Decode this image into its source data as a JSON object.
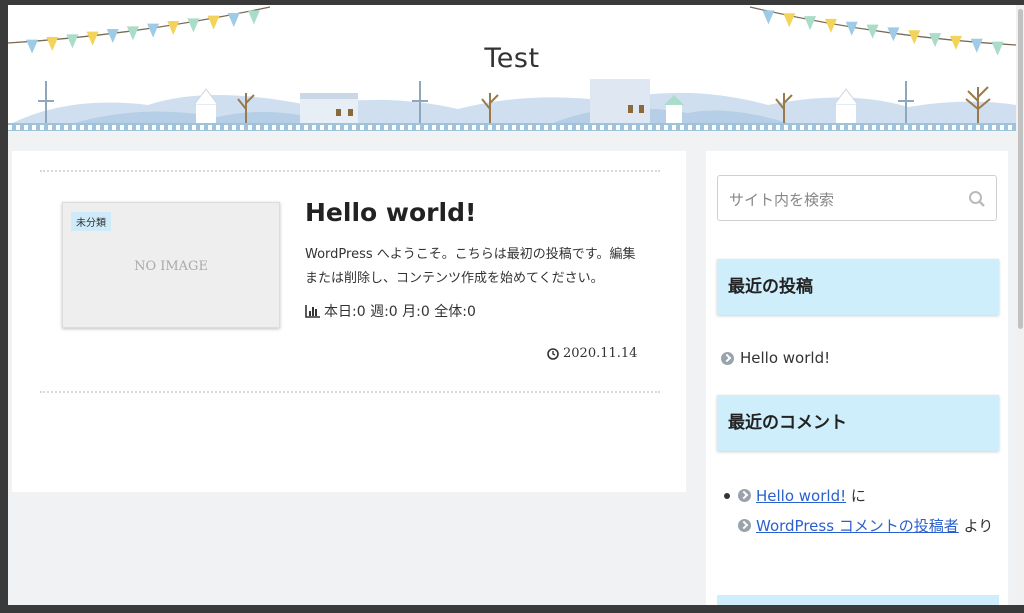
{
  "site": {
    "title": "Test"
  },
  "post": {
    "category": "未分類",
    "no_image": "NO IMAGE",
    "title": "Hello world!",
    "excerpt": "WordPress へようこそ。こちらは最初の投稿です。編集または削除し、コンテンツ作成を始めてください。",
    "stats": "本日:0 週:0 月:0 全体:0",
    "date": "2020.11.14"
  },
  "sidebar": {
    "search_placeholder": "サイト内を検索",
    "recent_posts_title": "最近の投稿",
    "recent_posts": [
      "Hello world!"
    ],
    "recent_comments_title": "最近のコメント",
    "comment": {
      "post_link": "Hello world!",
      "on_text": "に",
      "author_link": "WordPress コメントの投稿者",
      "by_text": "より"
    }
  },
  "icons": {
    "search": "search-icon",
    "chart": "bar-chart-icon",
    "clock": "clock-icon",
    "arrow": "circle-arrow-icon"
  },
  "colors": {
    "widget_header": "#cfeefc",
    "link": "#2a5fcf",
    "badge": "#cfeaf8"
  }
}
